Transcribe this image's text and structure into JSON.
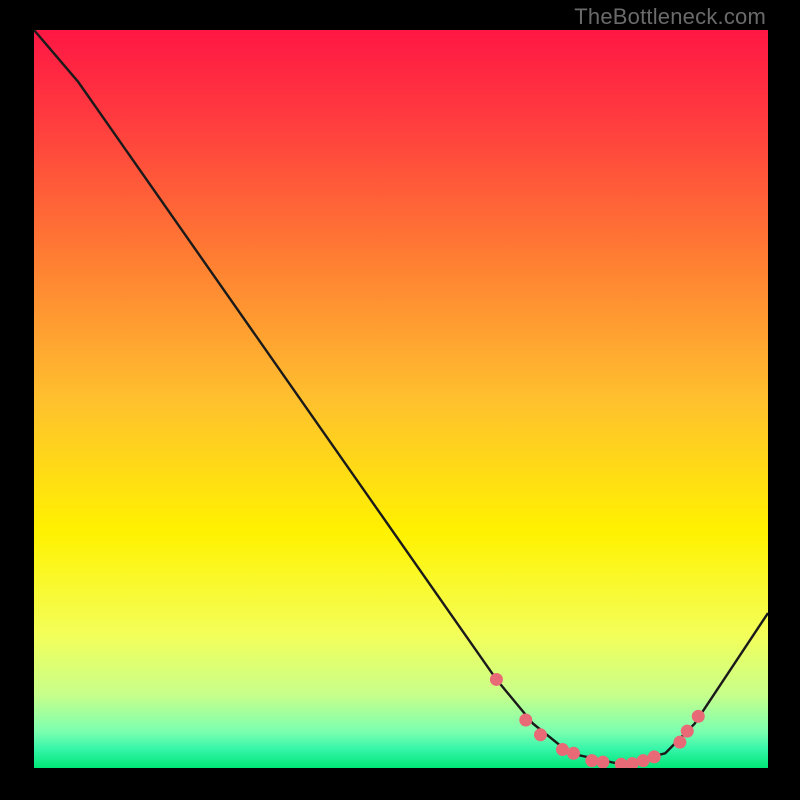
{
  "watermark": "TheBottleneck.com",
  "chart_data": {
    "type": "line",
    "title": "",
    "xlabel": "",
    "ylabel": "",
    "xlim": [
      0,
      100
    ],
    "ylim": [
      0,
      100
    ],
    "curve": [
      {
        "x": 0,
        "y": 100
      },
      {
        "x": 6,
        "y": 93
      },
      {
        "x": 63,
        "y": 12
      },
      {
        "x": 68,
        "y": 6
      },
      {
        "x": 73,
        "y": 2
      },
      {
        "x": 80,
        "y": 0.5
      },
      {
        "x": 86,
        "y": 2
      },
      {
        "x": 90,
        "y": 6
      },
      {
        "x": 100,
        "y": 21
      }
    ],
    "markers": [
      {
        "x": 63,
        "y": 12
      },
      {
        "x": 67,
        "y": 6.5
      },
      {
        "x": 69,
        "y": 4.5
      },
      {
        "x": 72,
        "y": 2.5
      },
      {
        "x": 73.5,
        "y": 2
      },
      {
        "x": 76,
        "y": 1
      },
      {
        "x": 77.5,
        "y": 0.8
      },
      {
        "x": 80,
        "y": 0.5
      },
      {
        "x": 81.5,
        "y": 0.6
      },
      {
        "x": 83,
        "y": 1
      },
      {
        "x": 84.5,
        "y": 1.5
      },
      {
        "x": 88,
        "y": 3.5
      },
      {
        "x": 89,
        "y": 5
      },
      {
        "x": 90.5,
        "y": 7
      }
    ],
    "gradient_stops": [
      {
        "offset": 0.0,
        "color": "#ff1744"
      },
      {
        "offset": 0.12,
        "color": "#ff3b3f"
      },
      {
        "offset": 0.3,
        "color": "#ff7a33"
      },
      {
        "offset": 0.5,
        "color": "#ffc02e"
      },
      {
        "offset": 0.68,
        "color": "#fff200"
      },
      {
        "offset": 0.82,
        "color": "#f3ff5a"
      },
      {
        "offset": 0.9,
        "color": "#c8ff8a"
      },
      {
        "offset": 0.95,
        "color": "#7dffb0"
      },
      {
        "offset": 0.975,
        "color": "#34f5a8"
      },
      {
        "offset": 1.0,
        "color": "#00e676"
      }
    ],
    "marker_color": "#e96a77",
    "line_color": "#1a1a1a"
  }
}
